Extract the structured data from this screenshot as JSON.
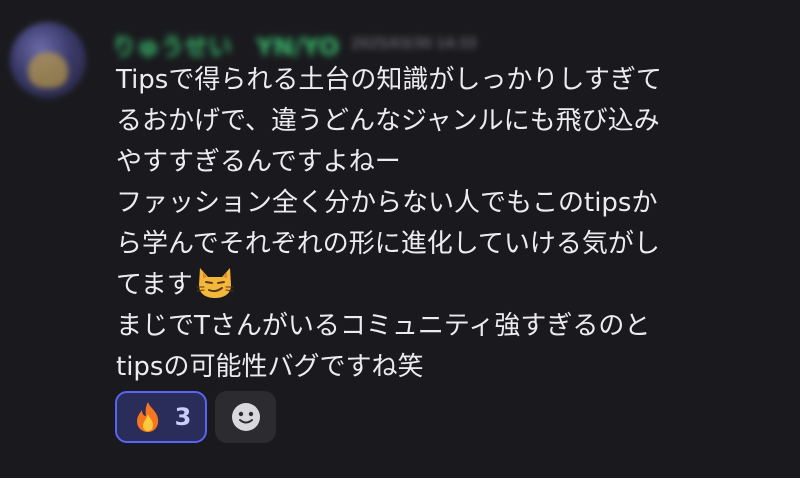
{
  "author": {
    "name": "りゅうせい　YN/YO",
    "timestamp": "2025/03/30 14:33"
  },
  "message": {
    "lines": [
      "Tipsで得られる土台の知識がしっかりしすぎて",
      "るおかげで、違うどんなジャンルにも飛び込み",
      "やすすぎるんですよねー",
      "ファッション全く分からない人でもこのtipsか",
      "ら学んでそれぞれの形に進化していける気がし",
      "てます",
      "まじでTさんがいるコミュニティ強すぎるのと",
      "tipsの可能性バグですね笑"
    ],
    "inline_emoji": "smirking-cat-emoji"
  },
  "reactions": [
    {
      "emoji": "fire",
      "count": "3",
      "active": true
    },
    {
      "emoji": "add-reaction",
      "active": false
    }
  ],
  "colors": {
    "background": "#1a1a1e",
    "username": "#39b86b",
    "reaction_active_border": "#5865f2",
    "reaction_active_bg": "#2a2d5a"
  }
}
